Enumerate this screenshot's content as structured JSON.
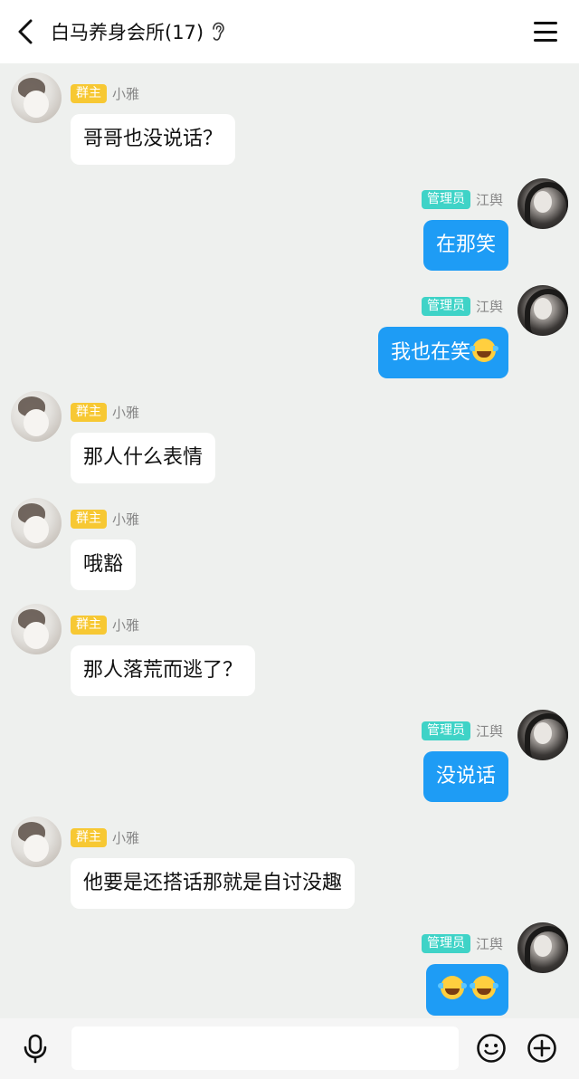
{
  "header": {
    "title": "白马养身会所(17)",
    "back_icon": "chevron-left-icon",
    "ear_icon": "ear-icon",
    "menu_icon": "hamburger-menu-icon"
  },
  "roles": {
    "owner": "群主",
    "admin": "管理员"
  },
  "messages": [
    {
      "side": "left",
      "role": "群主",
      "sender": "小雅",
      "text": "哥哥也没说话？",
      "emojis": 0
    },
    {
      "side": "right",
      "role": "管理员",
      "sender": "江舆",
      "text": "在那笑",
      "emojis": 0
    },
    {
      "side": "right",
      "role": "管理员",
      "sender": "江舆",
      "text": "我也在笑",
      "emojis": 1
    },
    {
      "side": "left",
      "role": "群主",
      "sender": "小雅",
      "text": "那人什么表情",
      "emojis": 0
    },
    {
      "side": "left",
      "role": "群主",
      "sender": "小雅",
      "text": "哦豁",
      "emojis": 0
    },
    {
      "side": "left",
      "role": "群主",
      "sender": "小雅",
      "text": "那人落荒而逃了？",
      "emojis": 0
    },
    {
      "side": "right",
      "role": "管理员",
      "sender": "江舆",
      "text": "没说话",
      "emojis": 0
    },
    {
      "side": "left",
      "role": "群主",
      "sender": "小雅",
      "text": "他要是还搭话那就是自讨没趣",
      "emojis": 0
    },
    {
      "side": "right",
      "role": "管理员",
      "sender": "江舆",
      "text": "",
      "emojis": 2
    }
  ],
  "input": {
    "value": "",
    "mic_icon": "microphone-icon",
    "emoji_icon": "smiley-icon",
    "plus_icon": "plus-circle-icon"
  },
  "colors": {
    "background": "#eef0ee",
    "right_bubble": "#1e9cf5",
    "left_bubble": "#ffffff",
    "owner_badge": "#f7c833",
    "admin_badge": "#3fd3c7"
  }
}
